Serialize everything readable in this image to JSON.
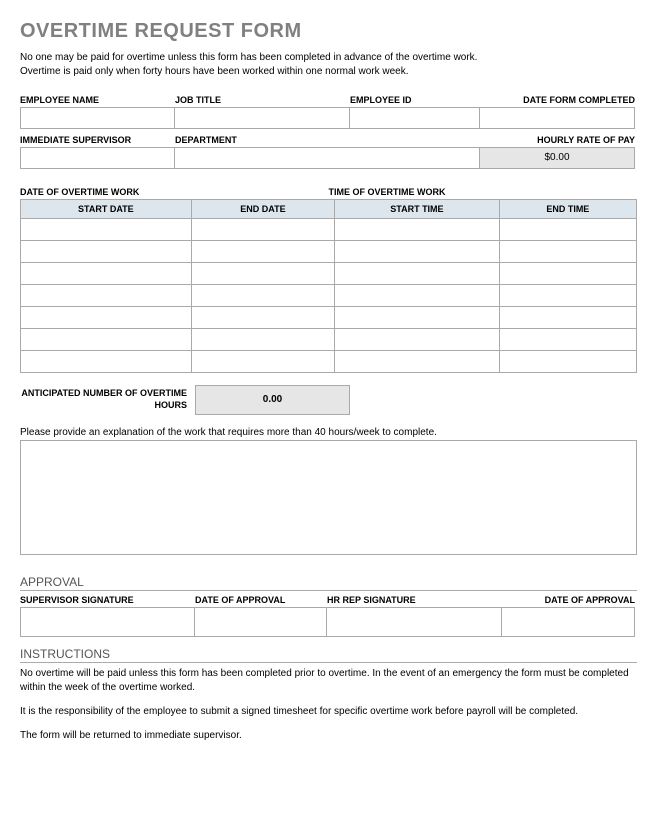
{
  "title": "OVERTIME REQUEST FORM",
  "intro_line1": "No one may be paid for overtime unless this form has been completed in advance of the overtime work.",
  "intro_line2": "Overtime is paid only when forty hours have been worked within one normal work week.",
  "labels": {
    "employee_name": "EMPLOYEE NAME",
    "job_title": "JOB TITLE",
    "employee_id": "EMPLOYEE ID",
    "date_form_completed": "DATE FORM COMPLETED",
    "immediate_supervisor": "IMMEDIATE SUPERVISOR",
    "department": "DEPARTMENT",
    "hourly_rate": "HOURLY RATE OF PAY",
    "date_of_ot": "DATE OF OVERTIME WORK",
    "time_of_ot": "TIME OF OVERTIME WORK",
    "start_date": "START DATE",
    "end_date": "END DATE",
    "start_time": "START TIME",
    "end_time": "END TIME",
    "anticipated": "ANTICIPATED NUMBER OF OVERTIME HOURS",
    "explain": "Please provide an explanation of the work that requires more than 40 hours/week to complete.",
    "approval": "APPROVAL",
    "supervisor_signature": "SUPERVISOR SIGNATURE",
    "date_of_approval": "DATE OF APPROVAL",
    "hr_rep_signature": "HR REP SIGNATURE",
    "instructions": "INSTRUCTIONS"
  },
  "values": {
    "hourly_rate": "$0.00",
    "anticipated_hours": "0.00"
  },
  "instructions": {
    "p1": "No overtime will be paid unless this form has been completed prior to overtime.  In the event of an emergency the form must be completed within the week of the overtime worked.",
    "p2": "It is the responsibility of the employee to submit a signed timesheet for specific overtime work before payroll will be completed.",
    "p3": "The form will be returned to immediate supervisor."
  }
}
